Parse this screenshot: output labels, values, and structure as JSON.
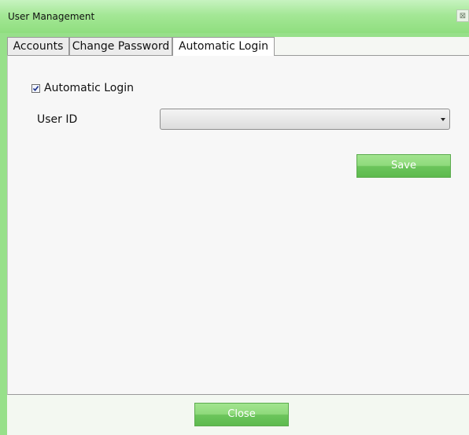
{
  "window": {
    "title": "User Management",
    "close_glyph": "⊠"
  },
  "tabs": [
    {
      "label": "Accounts",
      "active": false
    },
    {
      "label": "Change Password",
      "active": false
    },
    {
      "label": "Automatic Login",
      "active": true
    }
  ],
  "automatic_login": {
    "checkbox_label": "Automatic Login",
    "checked": true,
    "user_id_label": "User ID",
    "user_id_value": "",
    "save_label": "Save"
  },
  "footer": {
    "close_label": "Close"
  },
  "colors": {
    "accent_green": "#8fde7f",
    "button_green": "#6cc55c"
  }
}
